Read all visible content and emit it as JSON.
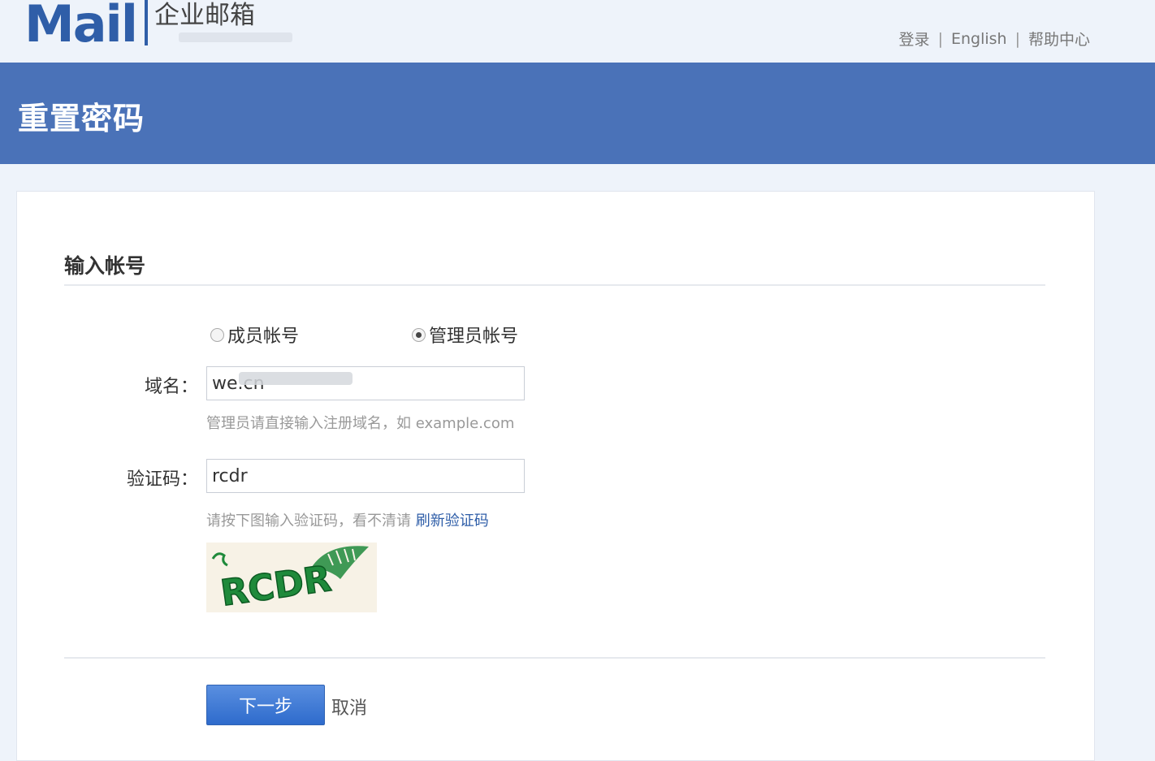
{
  "header": {
    "logo_text": "Mail",
    "logo_subtitle": "企业邮箱",
    "links": [
      "登录",
      "English",
      "帮助中心"
    ],
    "separator": "|"
  },
  "banner": {
    "title": "重置密码"
  },
  "form": {
    "section_title": "输入帐号",
    "account_types": [
      {
        "label": "成员帐号",
        "checked": false
      },
      {
        "label": "管理员帐号",
        "checked": true
      }
    ],
    "domain": {
      "label": "域名：",
      "value": "we.cn",
      "hint": "管理员请直接输入注册域名，如 example.com"
    },
    "captcha": {
      "label": "验证码：",
      "value": "rcdr",
      "hint_prefix": "请按下图输入验证码，看不清请 ",
      "refresh_link": "刷新验证码",
      "image_text": "RCDR"
    },
    "next_button": "下一步",
    "cancel_link": "取消"
  },
  "colors": {
    "brand": "#2f5ea8",
    "banner": "#4a72b8",
    "captcha_green": "#1f8a3b"
  }
}
